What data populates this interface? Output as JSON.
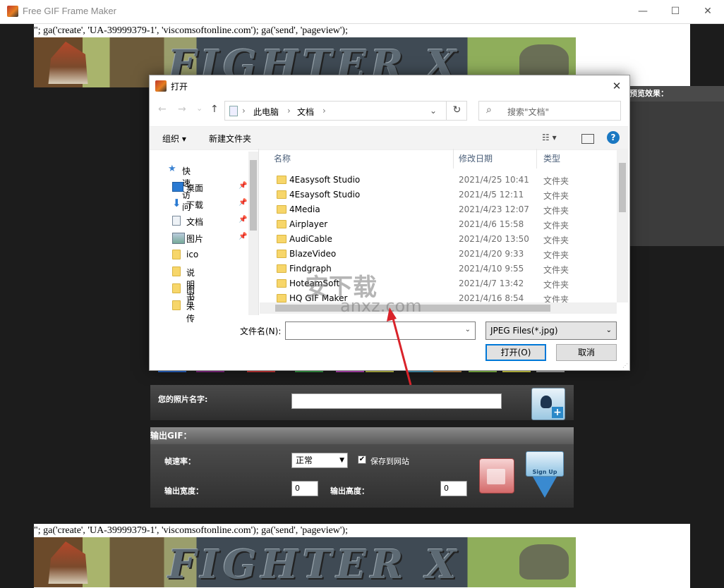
{
  "window": {
    "title": "Free GIF Frame Maker",
    "minimize": "—",
    "maximize": "☐",
    "close": "✕"
  },
  "web": {
    "script_text": "\"; ga('create', 'UA-39999379-1', 'viscomsoftonline.com'); ga('send', 'pageview');",
    "banner_text": "FIGHTER X",
    "preview_label": "预览效果：",
    "photo_name_label": "您的照片名字:",
    "output_title": "输出GIF：",
    "fps_label": "帧速率：",
    "fps_value": "正常",
    "save_site_label": "保存到网站",
    "save_site_checked": "✔",
    "width_label": "输出宽度：",
    "width_value": "0",
    "height_label": "输出高度：",
    "height_value": "0",
    "signup_label": "Sign Up"
  },
  "dialog": {
    "title": "打开",
    "close": "✕",
    "nav": {
      "back": "←",
      "forward": "→",
      "recent": "⌄",
      "up": "↑"
    },
    "breadcrumb": [
      "此电脑",
      "文档"
    ],
    "breadcrumb_sep": "›",
    "refresh": "↻",
    "search_placeholder": "搜索\"文档\"",
    "toolbar": {
      "organize": "组织 ▾",
      "new_folder": "新建文件夹",
      "view": "☷ ▾",
      "help": "?"
    },
    "nav_items": [
      {
        "label": "快速访问",
        "icon": "star-icon"
      },
      {
        "label": "桌面",
        "icon": "desktop-icon",
        "pinned": true
      },
      {
        "label": "下载",
        "icon": "download-icon",
        "pinned": true
      },
      {
        "label": "文档",
        "icon": "document-icon",
        "pinned": true
      },
      {
        "label": "图片",
        "icon": "picture-icon",
        "pinned": true
      },
      {
        "label": "ico",
        "icon": "folder-icon"
      },
      {
        "label": "说明书",
        "icon": "folder-icon"
      },
      {
        "label": "图片",
        "icon": "folder-icon"
      },
      {
        "label": "未传",
        "icon": "folder-icon"
      }
    ],
    "columns": {
      "name": "名称",
      "date": "修改日期",
      "type": "类型"
    },
    "files": [
      {
        "name": "4Easysoft Studio",
        "date": "2021/4/25 10:41",
        "type": "文件夹"
      },
      {
        "name": "4Esaysoft Studio",
        "date": "2021/4/5 12:11",
        "type": "文件夹"
      },
      {
        "name": "4Media",
        "date": "2021/4/23 12:07",
        "type": "文件夹"
      },
      {
        "name": "Airplayer",
        "date": "2021/4/6 15:58",
        "type": "文件夹"
      },
      {
        "name": "AudiCable",
        "date": "2021/4/20 13:50",
        "type": "文件夹"
      },
      {
        "name": "BlazeVideo",
        "date": "2021/4/20 9:33",
        "type": "文件夹"
      },
      {
        "name": "Findgraph",
        "date": "2021/4/10 9:55",
        "type": "文件夹"
      },
      {
        "name": "HoteamSoft",
        "date": "2021/4/7 13:42",
        "type": "文件夹"
      },
      {
        "name": "HQ GIF Maker",
        "date": "2021/4/16 8:54",
        "type": "文件夹"
      }
    ],
    "filename_label": "文件名(N):",
    "filename_value": "",
    "filter_value": "JPEG Files(*.jpg)",
    "open_button": "打开(O)",
    "cancel_button": "取消"
  },
  "watermark": {
    "text": "安下载",
    "domain": "anxz.com"
  },
  "colors": {
    "accent": "#0078d7",
    "folder": "#f7d66a",
    "annotation_arrow": "#d9232a"
  }
}
